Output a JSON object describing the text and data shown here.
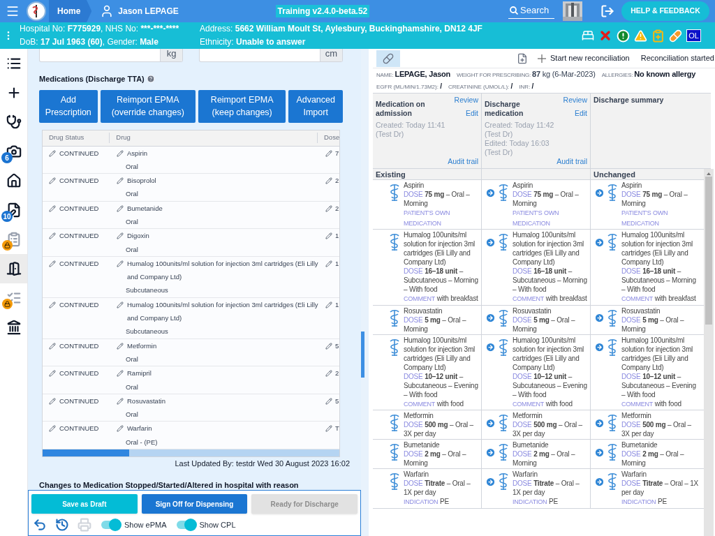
{
  "header": {
    "home": "Home",
    "patient": "Jason LEPAGE",
    "environment": "Training v2.4.0-beta.52",
    "search": "Search",
    "help": "HELP & FEEDBACK"
  },
  "info_bar": {
    "lines": [
      [
        {
          "label": "Hospital No: ",
          "value": "F775929"
        },
        {
          "label": ", NHS No: ",
          "value": "***-***-****"
        }
      ],
      [
        {
          "label": "DoB: ",
          "value": "17 Jul 1963 (60)"
        },
        {
          "label": ", Gender: ",
          "value": "Male"
        }
      ],
      [
        {
          "label": "Address: ",
          "value": "5662 William Moult St, Aylesbury, Buckinghamshire, DN12 4JF"
        }
      ],
      [
        {
          "label": "Ethnicity: ",
          "value": "Unable to answer"
        }
      ]
    ],
    "alerts": [
      {
        "kind": "bed"
      },
      {
        "kind": "cross"
      },
      {
        "kind": "exclamation"
      },
      {
        "kind": "warning"
      },
      {
        "kind": "clipboard"
      },
      {
        "kind": "pill"
      },
      {
        "kind": "badge",
        "text": "OL"
      }
    ]
  },
  "sidebar": {
    "items": [
      {
        "kind": "list",
        "selected": false,
        "locked": false
      },
      {
        "kind": "plus",
        "selected": false,
        "locked": false
      },
      {
        "kind": "stethoscope",
        "selected": false,
        "locked": false
      },
      {
        "kind": "camera",
        "badge": "6",
        "selected": false,
        "locked": false
      },
      {
        "kind": "home",
        "selected": false,
        "locked": false
      },
      {
        "kind": "document",
        "badge": "10",
        "selected": false,
        "locked": false
      },
      {
        "kind": "clipboard",
        "selected": false,
        "locked": true
      },
      {
        "kind": "door",
        "selected": true,
        "locked": false
      },
      {
        "kind": "checklist",
        "selected": false,
        "locked": true
      },
      {
        "kind": "building",
        "selected": false,
        "locked": false
      }
    ]
  },
  "form": {
    "fields": [
      {
        "unit": "kg"
      },
      {
        "unit": "cm"
      }
    ],
    "section_title": "Medications (Discharge TTA)",
    "buttons": [
      "Add Prescription",
      "Reimport EPMA (override changes)",
      "Reimport EPMA (keep changes)",
      "Advanced Import"
    ],
    "table": {
      "columns": [
        "Drug Status",
        "Drug",
        "Dose"
      ],
      "rows": [
        {
          "status": "CONTINUED",
          "drug": "Aspirin",
          "route": "Oral",
          "dose": "7"
        },
        {
          "status": "CONTINUED",
          "drug": "Bisoprolol",
          "route": "Oral",
          "dose": "2"
        },
        {
          "status": "CONTINUED",
          "drug": "Bumetanide",
          "route": "Oral",
          "dose": "2"
        },
        {
          "status": "CONTINUED",
          "drug": "Digoxin",
          "route": "Oral",
          "dose": "1"
        },
        {
          "status": "CONTINUED",
          "drug": "Humalog 100units/ml solution for injection 3ml cartridges (Eli Lilly and Company Ltd)",
          "route": "Subcutaneous",
          "dose": "1"
        },
        {
          "status": "CONTINUED",
          "drug": "Humalog 100units/ml solution for injection 3ml cartridges (Eli Lilly and Company Ltd)",
          "route": "Subcutaneous",
          "dose": "1"
        },
        {
          "status": "CONTINUED",
          "drug": "Metformin",
          "route": "Oral",
          "dose": "5"
        },
        {
          "status": "CONTINUED",
          "drug": "Ramipril",
          "route": "Oral",
          "dose": "2"
        },
        {
          "status": "CONTINUED",
          "drug": "Rosuvastatin",
          "route": "Oral",
          "dose": "5"
        },
        {
          "status": "CONTINUED",
          "drug": "Warfarin",
          "route": "Oral - (PE)",
          "dose": "T"
        }
      ]
    },
    "last_updated": "Last Updated By: testdr Wed 30 August 2023 16:02",
    "changes_title": "Changes to Medication Stopped/Started/Altered in hospital with reason"
  },
  "footer": {
    "buttons": [
      {
        "label": "Save as Draft",
        "disabled": false
      },
      {
        "label": "Sign Off for Dispensing",
        "disabled": false
      },
      {
        "label": "Ready for Discharge",
        "disabled": true
      }
    ],
    "tools": [
      {
        "kind": "undo",
        "disabled": false
      },
      {
        "kind": "history",
        "disabled": false
      },
      {
        "kind": "print",
        "disabled": true
      }
    ],
    "toggles": [
      {
        "label": "Show ePMA",
        "on": true
      },
      {
        "label": "Show CPL",
        "on": true
      }
    ]
  },
  "reconciliation": {
    "toolbar": {
      "pill_selected": true,
      "start": "Start new reconciliation",
      "started": "Reconciliation started"
    },
    "patient": [
      [
        {
          "label": "NAME:",
          "value": "LEPAGE, Jason",
          "bold": true
        },
        {
          "label": "WEIGHT FOR PRESCRIBING:",
          "value": "**87** kg (6-Mar-2023)",
          "bold": false
        },
        {
          "label": "ALLERGIES:",
          "value": "No known allergy",
          "bold": true
        }
      ],
      [
        {
          "label": "EGFR (ML/MIN/1.73M2):",
          "value": "/",
          "bold": true
        },
        {
          "label": "CREATININE (UMOL/L):",
          "value": "/",
          "bold": true
        },
        {
          "label": "INR:",
          "value": "/",
          "bold": true
        }
      ]
    ],
    "columns": [
      {
        "title": "Medication on admission",
        "links": [
          "Review",
          "Edit"
        ],
        "info": [
          "Created: Today 11:41",
          "(Test Dr)"
        ],
        "audit": "Audit trail"
      },
      {
        "title": "Discharge medication",
        "links": [
          "Review",
          "Edit"
        ],
        "info": [
          "Created: Today 11:42",
          "(Test Dr)",
          "Edited: Today 16:03",
          "(Test Dr)"
        ],
        "audit": "Audit trail"
      },
      {
        "title": "Discharge summary"
      }
    ],
    "groups": {
      "column_1": "Existing",
      "column_3": "Unchanged"
    },
    "rows": [
      {
        "cells": [
          {
            "arrow": false,
            "name": "Aspirin",
            "dose_label": "DOSE",
            "dose": "**75 mg** – Oral – Morning",
            "notes": [
              {
                "label": "PATIENT'S OWN MEDICATION"
              }
            ]
          },
          {
            "arrow": true,
            "name": "Aspirin",
            "dose_label": "DOSE",
            "dose": "**75 mg** – Oral – Morning",
            "notes": [
              {
                "label": "PATIENT'S OWN MEDICATION"
              }
            ]
          },
          {
            "arrow": true,
            "name": "Aspirin",
            "dose_label": "DOSE",
            "dose": "**75 mg** – Oral – Morning",
            "notes": [
              {
                "label": "PATIENT'S OWN MEDICATION"
              }
            ]
          }
        ]
      },
      {
        "cells": [
          {
            "arrow": false,
            "name": "Humalog 100units/ml solution for injection 3ml cartridges (Eli Lilly and Company Ltd)",
            "dose_label": "DOSE",
            "dose": "**16–18 unit** – Subcutaneous – Morning – With food",
            "notes": [
              {
                "label": "COMMENT",
                "text": "with breakfast"
              }
            ]
          },
          {
            "arrow": true,
            "name": "Humalog 100units/ml solution for injection 3ml cartridges (Eli Lilly and Company Ltd)",
            "dose_label": "DOSE",
            "dose": "**16–18 unit** – Subcutaneous – Morning – With food",
            "notes": [
              {
                "label": "COMMENT",
                "text": "with breakfast"
              }
            ]
          },
          {
            "arrow": true,
            "name": "Humalog 100units/ml solution for injection 3ml cartridges (Eli Lilly and Company Ltd)",
            "dose_label": "DOSE",
            "dose": "**16–18 unit** – Subcutaneous – Morning – With food",
            "notes": [
              {
                "label": "COMMENT",
                "text": "with breakfast"
              }
            ]
          }
        ]
      },
      {
        "cells": [
          {
            "arrow": false,
            "name": "Rosuvastatin",
            "dose_label": "DOSE",
            "dose": "**5 mg** – Oral – Morning"
          },
          {
            "arrow": true,
            "name": "Rosuvastatin",
            "dose_label": "DOSE",
            "dose": "**5 mg** – Oral – Morning"
          },
          {
            "arrow": true,
            "name": "Rosuvastatin",
            "dose_label": "DOSE",
            "dose": "**5 mg** – Oral – Morning"
          }
        ]
      },
      {
        "cells": [
          {
            "arrow": false,
            "name": "Humalog 100units/ml solution for injection 3ml cartridges (Eli Lilly and Company Ltd)",
            "dose_label": "DOSE",
            "dose": "**10–12 unit** – Subcutaneous – Evening – With food",
            "notes": [
              {
                "label": "COMMENT",
                "text": "with food"
              }
            ]
          },
          {
            "arrow": true,
            "name": "Humalog 100units/ml solution for injection 3ml cartridges (Eli Lilly and Company Ltd)",
            "dose_label": "DOSE",
            "dose": "**10–12 unit** – Subcutaneous – Evening – With food",
            "notes": [
              {
                "label": "COMMENT",
                "text": "with food"
              }
            ]
          },
          {
            "arrow": true,
            "name": "Humalog 100units/ml solution for injection 3ml cartridges (Eli Lilly and Company Ltd)",
            "dose_label": "DOSE",
            "dose": "**10–12 unit** – Subcutaneous – Evening – With food",
            "notes": [
              {
                "label": "COMMENT",
                "text": "with food"
              }
            ]
          }
        ]
      },
      {
        "cells": [
          {
            "arrow": false,
            "name": "Metformin",
            "dose_label": "DOSE",
            "dose": "**500 mg** – Oral – 3X per day"
          },
          {
            "arrow": true,
            "name": "Metformin",
            "dose_label": "DOSE",
            "dose": "**500 mg** – Oral – 3X per day"
          },
          {
            "arrow": true,
            "name": "Metformin",
            "dose_label": "DOSE",
            "dose": "**500 mg** – Oral – 3X per day"
          }
        ]
      },
      {
        "cells": [
          {
            "arrow": false,
            "name": "Bumetanide",
            "dose_label": "DOSE",
            "dose": "**2 mg** – Oral – Morning"
          },
          {
            "arrow": true,
            "name": "Bumetanide",
            "dose_label": "DOSE",
            "dose": "**2 mg** – Oral – Morning"
          },
          {
            "arrow": true,
            "name": "Bumetanide",
            "dose_label": "DOSE",
            "dose": "**2 mg** – Oral – Morning"
          }
        ]
      },
      {
        "cells": [
          {
            "arrow": false,
            "name": "Warfarin",
            "dose_label": "DOSE",
            "dose": "**Titrate** – Oral – 1X per day",
            "notes": [
              {
                "label": "INDICATION",
                "text": "PE"
              }
            ]
          },
          {
            "arrow": true,
            "name": "Warfarin",
            "dose_label": "DOSE",
            "dose": "**Titrate** – Oral – 1X per day",
            "notes": [
              {
                "label": "INDICATION",
                "text": "PE"
              }
            ]
          },
          {
            "arrow": true,
            "name": "Warfarin",
            "dose_label": "DOSE",
            "dose": "**Titrate** – Oral – 1X per day",
            "notes": [
              {
                "label": "INDICATION",
                "text": "PE"
              }
            ]
          }
        ]
      }
    ]
  }
}
